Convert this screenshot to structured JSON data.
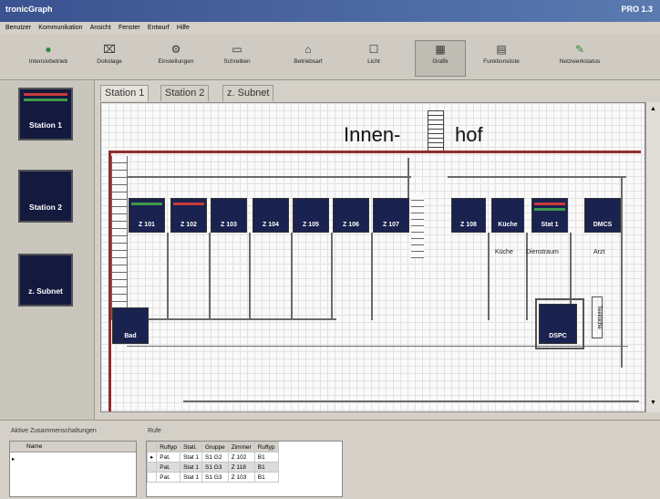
{
  "app": {
    "title": "tronicGraph",
    "title_right": "PRO 1.3"
  },
  "menu": [
    "Benutzer",
    "Kommunikation",
    "Ansicht",
    "Fenster",
    "Entwurf",
    "Hilfe"
  ],
  "toolbar": [
    {
      "label": "Intensivbetrieb",
      "icon": "●"
    },
    {
      "label": "Dokolage",
      "icon": "⌧"
    },
    {
      "label": "Einstellungen",
      "icon": "⚙"
    },
    {
      "label": "Schreiben",
      "icon": "▭"
    },
    {
      "label": "Betriebsart",
      "icon": "⌂"
    },
    {
      "label": "Licht",
      "icon": "☐"
    },
    {
      "label": "Grafik",
      "icon": "▦"
    },
    {
      "label": "Funktionsliste",
      "icon": "▤"
    },
    {
      "label": "Netzwerkstatus",
      "icon": "✎"
    }
  ],
  "stations": [
    {
      "label": "Station 1",
      "bar_colors": [
        "#c83a3a",
        "#3e9a4a"
      ]
    },
    {
      "label": "Station 2",
      "bar_colors": []
    },
    {
      "label": "z. Subnet",
      "bar_colors": []
    }
  ],
  "tabs": [
    "Station 1",
    "Station 2",
    "z. Subnet"
  ],
  "plan": {
    "title_left": "Innen-",
    "title_right": "hof",
    "rooms": [
      {
        "label": "Z 101",
        "bar_colors": [
          "#3e9a4a"
        ]
      },
      {
        "label": "Z 102",
        "bar_colors": [
          "#c83a3a"
        ]
      },
      {
        "label": "Z 103",
        "bar_colors": []
      },
      {
        "label": "Z 104",
        "bar_colors": []
      },
      {
        "label": "Z 105",
        "bar_colors": []
      },
      {
        "label": "Z 106",
        "bar_colors": []
      },
      {
        "label": "Z 107",
        "bar_colors": []
      },
      {
        "label": "Z 108",
        "bar_colors": []
      },
      {
        "label": "Küche",
        "bar_colors": []
      },
      {
        "label": "Stat 1",
        "bar_colors": [
          "#c83a3a",
          "#3e9a4a"
        ]
      },
      {
        "label": "DMCS",
        "bar_colors": []
      }
    ],
    "sublabels": [
      "Küche",
      "Dienstraum",
      "Arzt"
    ],
    "bad": "Bad",
    "dspc": "DSPC",
    "vertical_label": "Teeküche"
  },
  "bottom": {
    "active_label": "Aktive Zusammenschaltungen",
    "name_header": "Name",
    "calls_label": "Rufe",
    "columns": [
      "Ruftyp",
      "Stati.",
      "Gruppe",
      "Zimmer",
      "Ruftyp"
    ],
    "rows": [
      [
        "Pat.",
        "Stat 1",
        "S1 G2",
        "Z 102",
        "B1"
      ],
      [
        "Pat.",
        "Stat 1",
        "S1 G3",
        "Z 118",
        "B1"
      ],
      [
        "Pat.",
        "Stat 1",
        "S1 G3",
        "Z 103",
        "B1"
      ]
    ]
  }
}
